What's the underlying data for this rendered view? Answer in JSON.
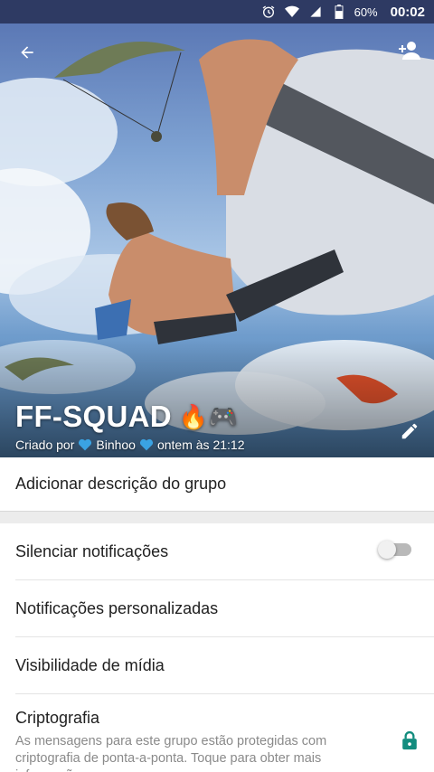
{
  "statusbar": {
    "battery": "60%",
    "time": "00:02",
    "icons": [
      "alarm-icon",
      "wifi-icon",
      "signal-icon",
      "battery-icon"
    ]
  },
  "header": {
    "back_icon": "arrow-back-icon",
    "add_participant_icon": "person-add-icon",
    "edit_icon": "pencil-icon"
  },
  "group": {
    "name": "FF-SQUAD",
    "emoji": "🔥🎮",
    "created_prefix": "Criado por",
    "creator": "Binhoo",
    "created_when": "ontem às 21:12"
  },
  "description": {
    "placeholder": "Adicionar descrição do grupo"
  },
  "settings": {
    "mute_label": "Silenciar notificações",
    "mute_enabled": false,
    "custom_notifications_label": "Notificações personalizadas",
    "media_visibility_label": "Visibilidade de mídia",
    "encryption_label": "Criptografia",
    "encryption_text": "As mensagens para este grupo estão protegidas com criptografia de ponta-a-ponta.  Toque para obter mais informações."
  },
  "colors": {
    "statusbar": "#2e3a63",
    "accent_green": "#128c7e",
    "heart_blue": "#3aa3e3"
  }
}
